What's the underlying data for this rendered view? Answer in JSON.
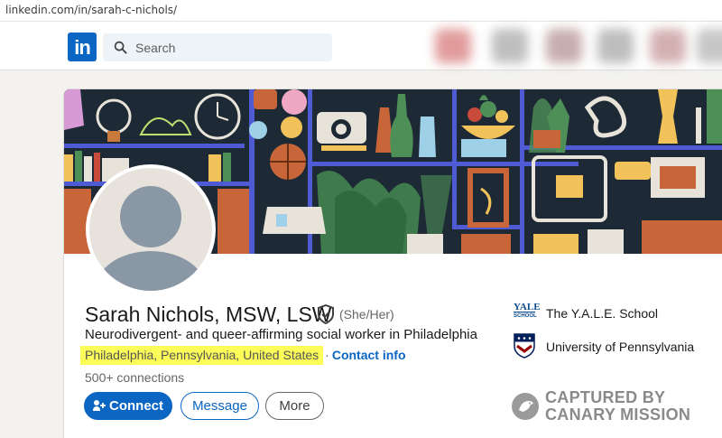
{
  "browser": {
    "url": "linkedin.com/in/sarah-c-nichols/"
  },
  "nav": {
    "logo_text": "in",
    "search_placeholder": "Search"
  },
  "profile": {
    "name": "Sarah Nichols, MSW, LSW",
    "pronouns": "(She/Her)",
    "headline": "Neurodivergent- and queer-affirming social worker in Philadelphia",
    "location": "Philadelphia, Pennsylvania, United States",
    "separator": "·",
    "contact_info": "Contact info",
    "connections": "500+ connections"
  },
  "actions": {
    "connect": "Connect",
    "message": "Message",
    "more": "More"
  },
  "education": [
    {
      "logo_text_1": "YALE",
      "logo_text_2": "SCHOOL",
      "label": "The Y.A.L.E. School"
    },
    {
      "label": "University of Pennsylvania"
    }
  ],
  "watermark": {
    "line1": "CAPTURED BY",
    "line2": "CANARY MISSION"
  },
  "colors": {
    "brand": "#0a66c2",
    "highlight": "#fdfd5a",
    "banner_bg": "#1d2a36",
    "banner_accent": "#4f5bd5"
  },
  "icons": [
    "search-icon",
    "verified-shield-icon",
    "connect-plus-icon",
    "yale-logo",
    "penn-shield-logo",
    "canary-bird-icon"
  ]
}
